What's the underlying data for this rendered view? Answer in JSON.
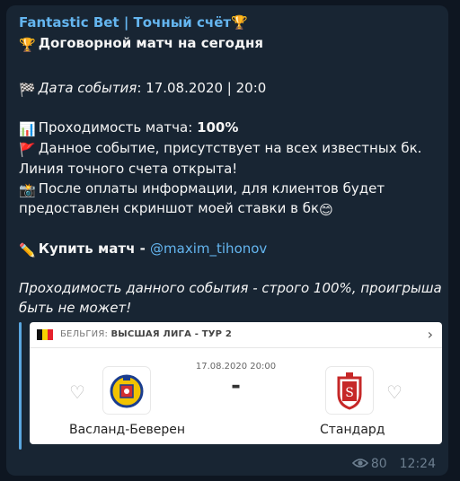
{
  "message": {
    "channel_title": "Fantastic Bet | Точный счёт🏆",
    "headline": "Договорной матч на сегодня",
    "headline_emoji": "🏆",
    "date_emoji": "🏁",
    "date_label": "Дата события",
    "date_value": ": 17.08.2020 | 20:0",
    "pass_emoji": "📊",
    "pass_label": "Проходимость матча: ",
    "pass_value": "100%",
    "flag_emoji": "🚩",
    "line1": "Данное событие, присутствует на всех известных бк.",
    "line2": "Линия точного счета открыта!",
    "camera_emoji": "📸",
    "line3": "После оплаты информации, для клиентов будет",
    "line4": "предоставлен скриншот моей ставки в бк",
    "smile_emoji": "😊",
    "pencil_emoji": "✏️",
    "buy_label": "Купить матч - ",
    "buy_link": "@maxim_tihonov",
    "footer_line1": "Проходимость данного события - строго 100%, проигрыша",
    "footer_line2": "быть не может!"
  },
  "card": {
    "country": "БЕЛЬГИЯ: ",
    "league": "ВЫСШАЯ ЛИГА - ТУР 2",
    "datetime": "17.08.2020 20:00",
    "score": "-",
    "home_team": "Васланд-Беверен",
    "away_team": "Стандард",
    "heart": "♡",
    "chevron": "›"
  },
  "meta": {
    "views": "80",
    "time": "12:24",
    "eye_icon": "eye-icon"
  },
  "colors": {
    "background": "#0e1621",
    "bubble": "#182533",
    "link": "#64b5ef",
    "text": "#f5f5f5"
  }
}
